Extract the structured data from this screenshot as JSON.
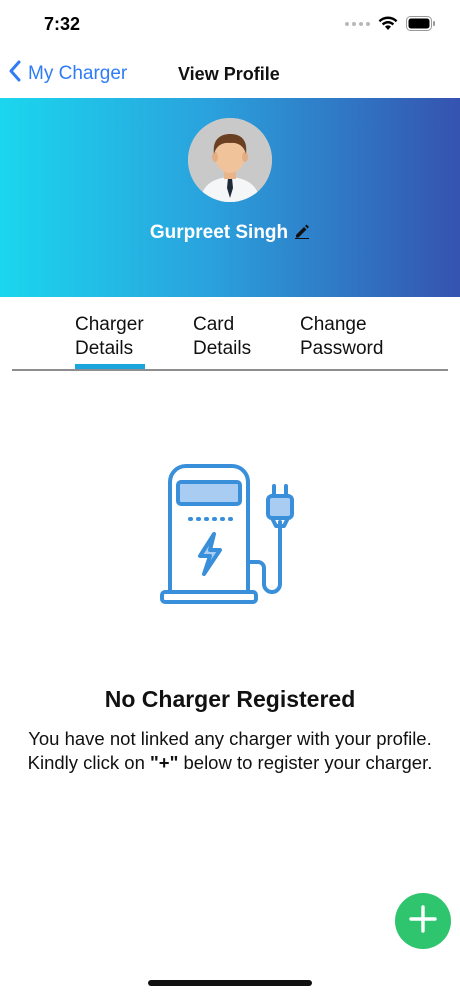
{
  "status_bar": {
    "time": "7:32"
  },
  "nav": {
    "back_label": "My Charger",
    "title": "View Profile"
  },
  "profile": {
    "name": "Gurpreet Singh"
  },
  "tabs": [
    {
      "line1": "Charger",
      "line2": "Details"
    },
    {
      "line1": "Card",
      "line2": "Details"
    },
    {
      "line1": "Change",
      "line2": "Password"
    }
  ],
  "empty_state": {
    "title": "No Charger Registered",
    "message_part1": "You have not linked any charger with your profile. Kindly click on ",
    "message_highlight": "\"+\"",
    "message_part2": " below to register your charger."
  },
  "colors": {
    "accent_blue": "#2f7cf6",
    "banner_start": "#1bd6ee",
    "banner_end": "#3553b0",
    "tab_indicator": "#1aa6dc",
    "fab": "#2fc46e",
    "illustration": "#3a8fdb"
  },
  "icons": {
    "back": "chevron-left-icon",
    "edit": "pencil-icon",
    "add": "plus-icon",
    "illustration": "ev-charger-icon"
  }
}
